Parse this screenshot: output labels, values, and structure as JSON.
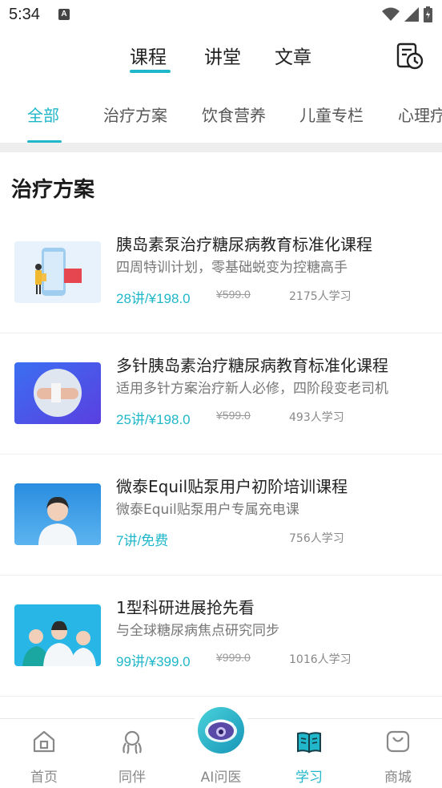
{
  "status_bar": {
    "time": "5:34",
    "notification_icon": "A"
  },
  "top_tabs": [
    {
      "label": "课程",
      "active": true
    },
    {
      "label": "讲堂",
      "active": false
    },
    {
      "label": "文章",
      "active": false
    }
  ],
  "categories": [
    {
      "label": "全部",
      "active": true
    },
    {
      "label": "治疗方案",
      "active": false
    },
    {
      "label": "饮食营养",
      "active": false
    },
    {
      "label": "儿童专栏",
      "active": false
    },
    {
      "label": "心理疗",
      "active": false
    }
  ],
  "section_title": "治疗方案",
  "courses": [
    {
      "title": "胰岛素泵治疗糖尿病教育标准化课程",
      "subtitle": "四周特训计划，零基础蜕变为控糖高手",
      "price": "28讲/¥198.0",
      "original_price": "¥599.0",
      "learners": "2175人学习",
      "thumb": "phone-illustration"
    },
    {
      "title": "多针胰岛素治疗糖尿病教育标准化课程",
      "subtitle": "适用多针方案治疗新人必修，四阶段变老司机",
      "price": "25讲/¥198.0",
      "original_price": "¥599.0",
      "learners": "493人学习",
      "thumb": "injection-photo"
    },
    {
      "title": "微泰Equil贴泵用户初阶培训课程",
      "subtitle": "微泰Equil贴泵用户专属充电课",
      "price": "7讲/免费",
      "original_price": "",
      "learners": "756人学习",
      "thumb": "doctor-photo"
    },
    {
      "title": "1型科研进展抢先看",
      "subtitle": "与全球糖尿病焦点研究同步",
      "price": "99讲/¥399.0",
      "original_price": "¥999.0",
      "learners": "1016人学习",
      "thumb": "doctors-group-photo"
    }
  ],
  "bottom_nav": [
    {
      "label": "首页",
      "icon": "home-icon",
      "active": false
    },
    {
      "label": "同伴",
      "icon": "companion-icon",
      "active": false
    },
    {
      "label": "AI问医",
      "icon": "ai-doctor-icon",
      "active": false
    },
    {
      "label": "学习",
      "icon": "book-icon",
      "active": true
    },
    {
      "label": "商城",
      "icon": "shop-bag-icon",
      "active": false
    }
  ],
  "colors": {
    "accent": "#1fb7c9",
    "text": "#222222",
    "muted": "#777777"
  }
}
